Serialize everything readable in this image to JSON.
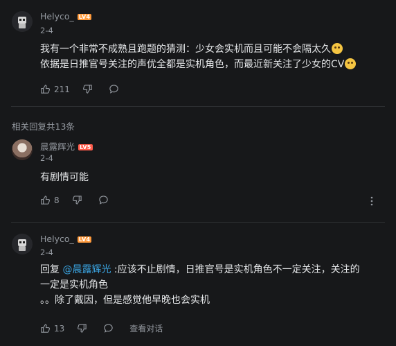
{
  "comments": [
    {
      "username": "Helyco_",
      "level": "LV4",
      "date": "2-4",
      "lines": [
        "我有一个非常不成熟且跑题的猜测：少女会实机而且可能不会隔太久",
        "依据是日推官号关注的声优全都是实机角色，而最近新关注了少女的CV"
      ],
      "likes": "211"
    }
  ],
  "replies_header": "相关回复共13条",
  "replies": [
    {
      "username": "晨露辉光",
      "level": "LV5",
      "date": "2-4",
      "text": "有剧情可能",
      "likes": "8"
    },
    {
      "username": "Helyco_",
      "level": "LV4",
      "date": "2-4",
      "reply_prefix": "回复 ",
      "mention": "@晨露辉光",
      "line1": " :应该不止剧情，日推官号是实机角色不一定关注，关注的",
      "line2": "一定是实机角色",
      "line3": "。。除了戴因，但是感觉他早晚也会实机",
      "likes": "13",
      "view_dialog": "查看对话"
    }
  ],
  "icons": [
    "like-icon",
    "dislike-icon",
    "comment-icon",
    "more-icon",
    "robot-avatar",
    "emoji-face"
  ],
  "colors": {
    "background": "#17181a",
    "text": "#e3e5e7",
    "muted": "#9499a0",
    "mention": "#3aa3e0",
    "lv4": "#ff9a3c",
    "lv5": "#ff5b4a"
  }
}
